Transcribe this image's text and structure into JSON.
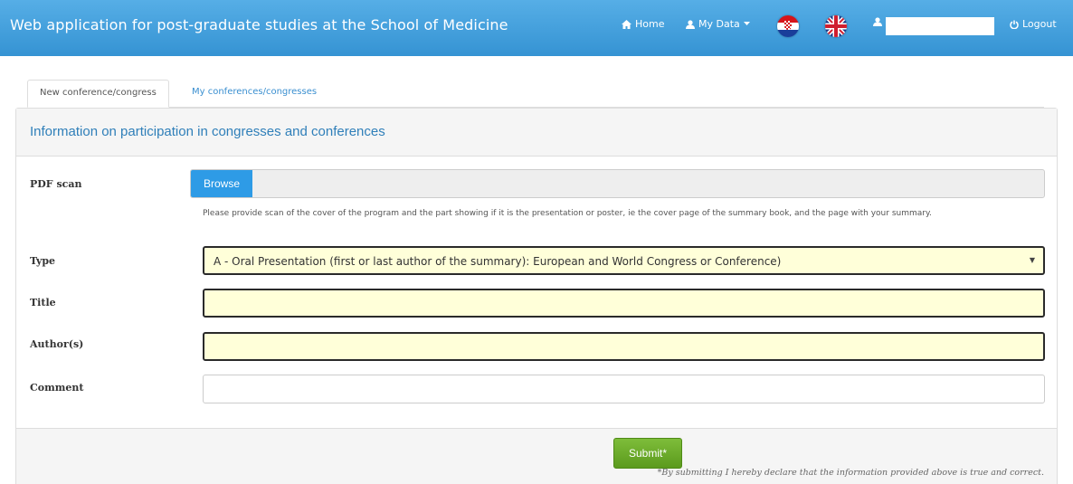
{
  "navbar": {
    "title": "Web application for post-graduate studies at the School of Medicine",
    "home_label": "Home",
    "mydata_label": "My Data",
    "logout_label": "Logout",
    "username": "",
    "accent_color": "#3a9ad9"
  },
  "tabs": [
    {
      "label": "New conference/congress",
      "active": true
    },
    {
      "label": "My conferences/congresses",
      "active": false
    }
  ],
  "panel": {
    "title": "Information on participation in congresses and conferences"
  },
  "form": {
    "pdf_label": "PDF scan",
    "browse_label": "Browse",
    "help_text": "Please provide scan of the cover of the program and the part showing if it is the presentation or poster, ie the cover page of the summary book, and the page with your summary.",
    "type_label": "Type",
    "type_value": "A - Oral Presentation (first or last author of the summary): European and World Congress or Conference)",
    "title_label": "Title",
    "title_value": "",
    "authors_label": "Author(s)",
    "authors_value": "",
    "comment_label": "Comment",
    "comment_value": ""
  },
  "footer": {
    "submit_label": "Submit*",
    "declaration": "*By submitting I hereby declare that the information provided above is true and correct."
  }
}
